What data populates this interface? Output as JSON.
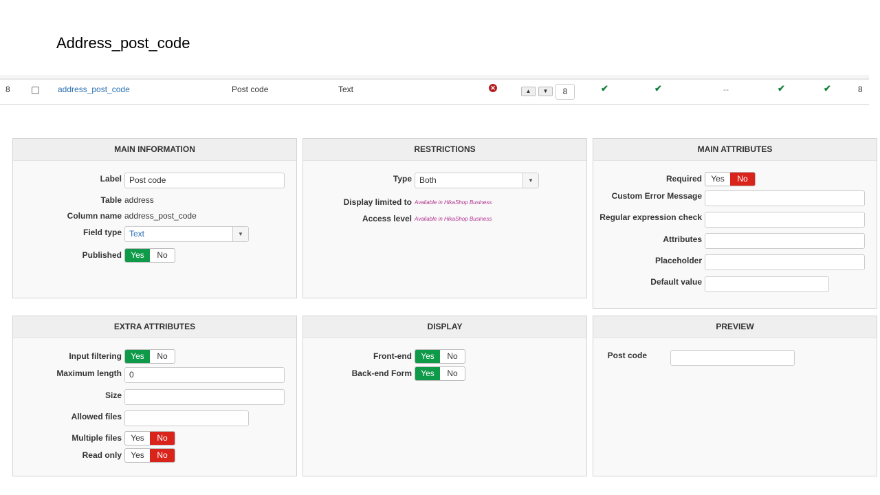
{
  "title": "Address_post_code",
  "row": {
    "id": "8",
    "name": "address_post_code",
    "label": "Post code",
    "type": "Text",
    "ordering": "8",
    "dash": "--",
    "last": "8"
  },
  "main_info": {
    "header": "MAIN INFORMATION",
    "label_l": "Label",
    "label_v": "Post code",
    "table_l": "Table",
    "table_v": "address",
    "col_l": "Column name",
    "col_v": "address_post_code",
    "ft_l": "Field type",
    "ft_v": "Text",
    "pub_l": "Published"
  },
  "restrictions": {
    "header": "RESTRICTIONS",
    "type_l": "Type",
    "type_v": "Both",
    "disp_l": "Display limited to",
    "disp_v": "Available in HikaShop Business",
    "acc_l": "Access level",
    "acc_v": "Available in HikaShop Business"
  },
  "main_attr": {
    "header": "MAIN ATTRIBUTES",
    "req_l": "Required",
    "err_l": "Custom Error Message",
    "regex_l": "Regular expression check",
    "attr_l": "Attributes",
    "ph_l": "Placeholder",
    "def_l": "Default value"
  },
  "extra": {
    "header": "EXTRA ATTRIBUTES",
    "filt_l": "Input filtering",
    "max_l": "Maximum length",
    "max_v": "0",
    "size_l": "Size",
    "allowed_l": "Allowed files",
    "multi_l": "Multiple files",
    "ro_l": "Read only"
  },
  "display": {
    "header": "DISPLAY",
    "front_l": "Front-end",
    "back_l": "Back-end Form"
  },
  "preview": {
    "header": "PREVIEW",
    "pc_l": "Post code"
  },
  "yes": "Yes",
  "no": "No",
  "colors": {
    "green": "#0e9a48",
    "red": "#d9241c"
  }
}
